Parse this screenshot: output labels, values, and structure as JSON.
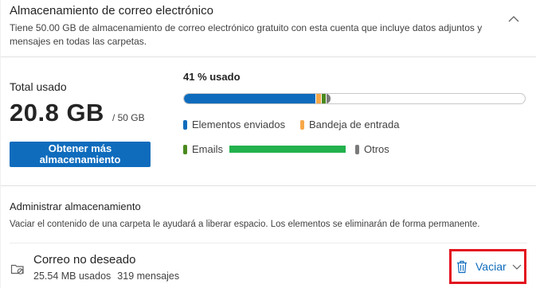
{
  "header": {
    "title": "Almacenamiento de correo electrónico",
    "description": "Tiene 50.00 GB de almacenamiento de correo electrónico gratuito con esta cuenta que incluye datos adjuntos y mensajes en todas las carpetas.",
    "collapse_icon": "chevron-up-icon"
  },
  "usage": {
    "total_label": "Total usado",
    "total_value": "20.8 GB",
    "total_capacity": "/ 50 GB",
    "percent_label": "41 % usado",
    "get_more_button": "Obtener más almacenamiento",
    "bar_segments": [
      {
        "name": "Elementos enviados",
        "fraction": 0.385,
        "color": "#0f6cbd"
      },
      {
        "name": "Bandeja de entrada",
        "fraction": 0.018,
        "color": "#f7a84a"
      },
      {
        "name": "Emails",
        "fraction": 0.014,
        "color": "#4a8a1e"
      },
      {
        "name": "Otros",
        "fraction": 0.014,
        "color": "#7a7a7a"
      }
    ],
    "legend": {
      "sent": {
        "label": "Elementos enviados",
        "color": "#0f6cbd"
      },
      "inbox": {
        "label": "Bandeja de entrada",
        "color": "#f7a84a"
      },
      "emails": {
        "label": "Emails",
        "color": "#4a8a1e"
      },
      "other": {
        "label": "Otros",
        "color": "#7a7a7a"
      }
    }
  },
  "manage": {
    "title": "Administrar almacenamiento",
    "description": "Vaciar el contenido de una carpeta le ayudará a liberar espacio. Los elementos se eliminarán de forma permanente.",
    "folder": {
      "name": "Correo no deseado",
      "size": "25.54 MB usados",
      "count": "319 mensajes",
      "icon": "junk-folder-icon"
    },
    "empty_button": {
      "label": "Vaciar",
      "icon": "trash-icon",
      "menu_icon": "chevron-down-icon"
    }
  }
}
